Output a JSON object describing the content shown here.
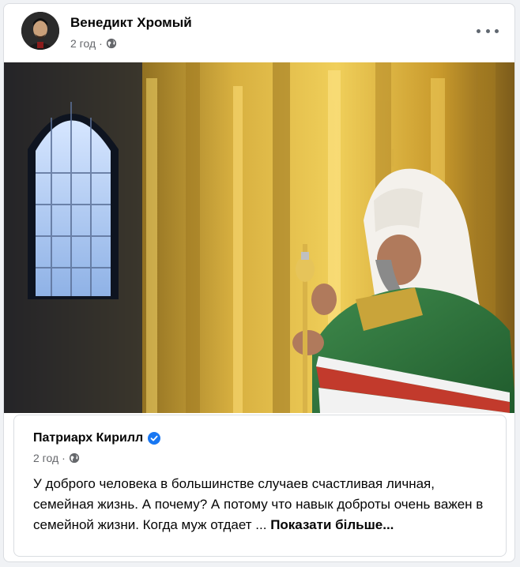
{
  "post": {
    "author": "Венедикт Хромый",
    "time": "2 год",
    "separator": "·",
    "privacy_icon": "globe-icon",
    "more_icon": "more-options-icon"
  },
  "shared_post": {
    "author": "Патриарх Кирилл",
    "verified_icon": "verified-badge-icon",
    "time": "2 год",
    "separator": "·",
    "privacy_icon": "globe-icon",
    "text": "У доброго человека в большинстве случаев счастливая личная, семейная жизнь. А почему? А потому что навык доброты очень важен в семейной жизни. Когда муж отдает ... ",
    "see_more": "Показати більше..."
  },
  "colors": {
    "accent": "#1877f2",
    "secondary_text": "#65676b",
    "primary_text": "#050505"
  }
}
